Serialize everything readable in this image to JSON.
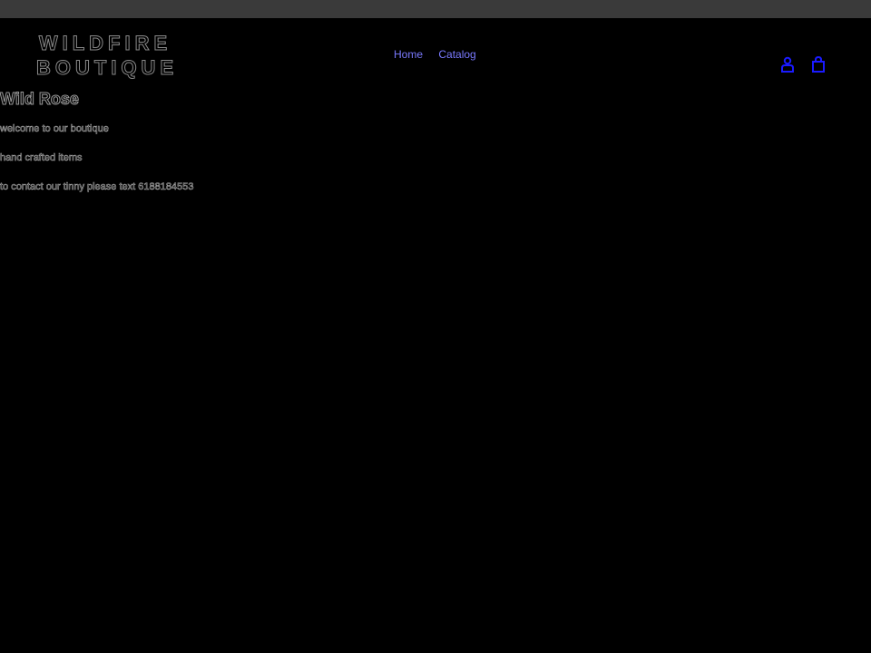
{
  "header": {
    "logo_line1": "WILDFIRE",
    "logo_line2": "BOUTIQUE",
    "nav": [
      {
        "label": "Home"
      },
      {
        "label": "Catalog"
      }
    ],
    "icons": {
      "account": "account-icon",
      "cart": "cart-icon"
    },
    "colors": {
      "link": "#7a7aff",
      "icon": "#1a1aff",
      "topbar": "#3a3a3a",
      "background": "#000000"
    }
  },
  "main": {
    "title": "Wild Rose",
    "paragraphs": [
      "welcome to our boutique",
      "hand crafted items",
      "to contact our tinny please text 6188184553"
    ]
  }
}
